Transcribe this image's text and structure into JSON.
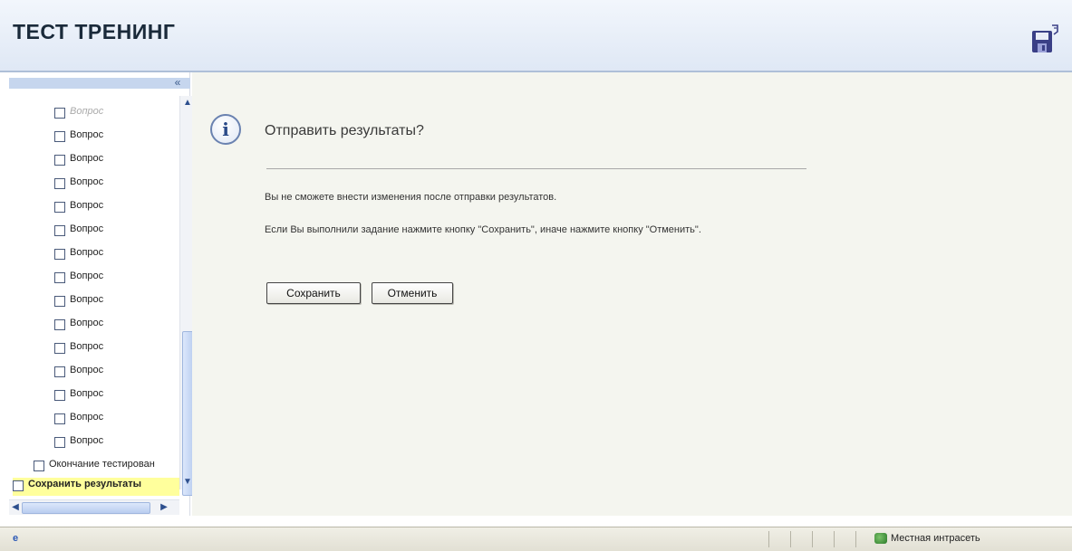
{
  "header": {
    "title": "ТЕСТ ТРЕНИНГ",
    "save_icon": "save-disk-icon"
  },
  "sidebar": {
    "items": [
      {
        "label": "Вопрос",
        "state": "faded"
      },
      {
        "label": "Вопрос",
        "state": "normal"
      },
      {
        "label": "Вопрос",
        "state": "normal"
      },
      {
        "label": "Вопрос",
        "state": "normal"
      },
      {
        "label": "Вопрос",
        "state": "normal"
      },
      {
        "label": "Вопрос",
        "state": "normal"
      },
      {
        "label": "Вопрос",
        "state": "normal"
      },
      {
        "label": "Вопрос",
        "state": "normal"
      },
      {
        "label": "Вопрос",
        "state": "normal"
      },
      {
        "label": "Вопрос",
        "state": "normal"
      },
      {
        "label": "Вопрос",
        "state": "normal"
      },
      {
        "label": "Вопрос",
        "state": "normal"
      },
      {
        "label": "Вопрос",
        "state": "normal"
      },
      {
        "label": "Вопрос",
        "state": "normal"
      },
      {
        "label": "Вопрос",
        "state": "normal"
      },
      {
        "label": "Окончание тестирован",
        "state": "normal"
      },
      {
        "label": "Сохранить результаты",
        "state": "bold-highlight"
      }
    ]
  },
  "dialog": {
    "title": "Отправить результаты?",
    "message_1": "Вы не сможете внести изменения после отправки результатов.",
    "message_2": "Если Вы выполнили задание нажмите кнопку \"Сохранить\", иначе нажмите кнопку \"Отменить\".",
    "save_label": "Сохранить",
    "cancel_label": "Отменить"
  },
  "status_bar": {
    "zone_label": "Местная интрасеть"
  },
  "colors": {
    "header_bg": "#dfe8f5",
    "main_bg": "#f4f5ef",
    "highlight": "#ffff9c"
  }
}
